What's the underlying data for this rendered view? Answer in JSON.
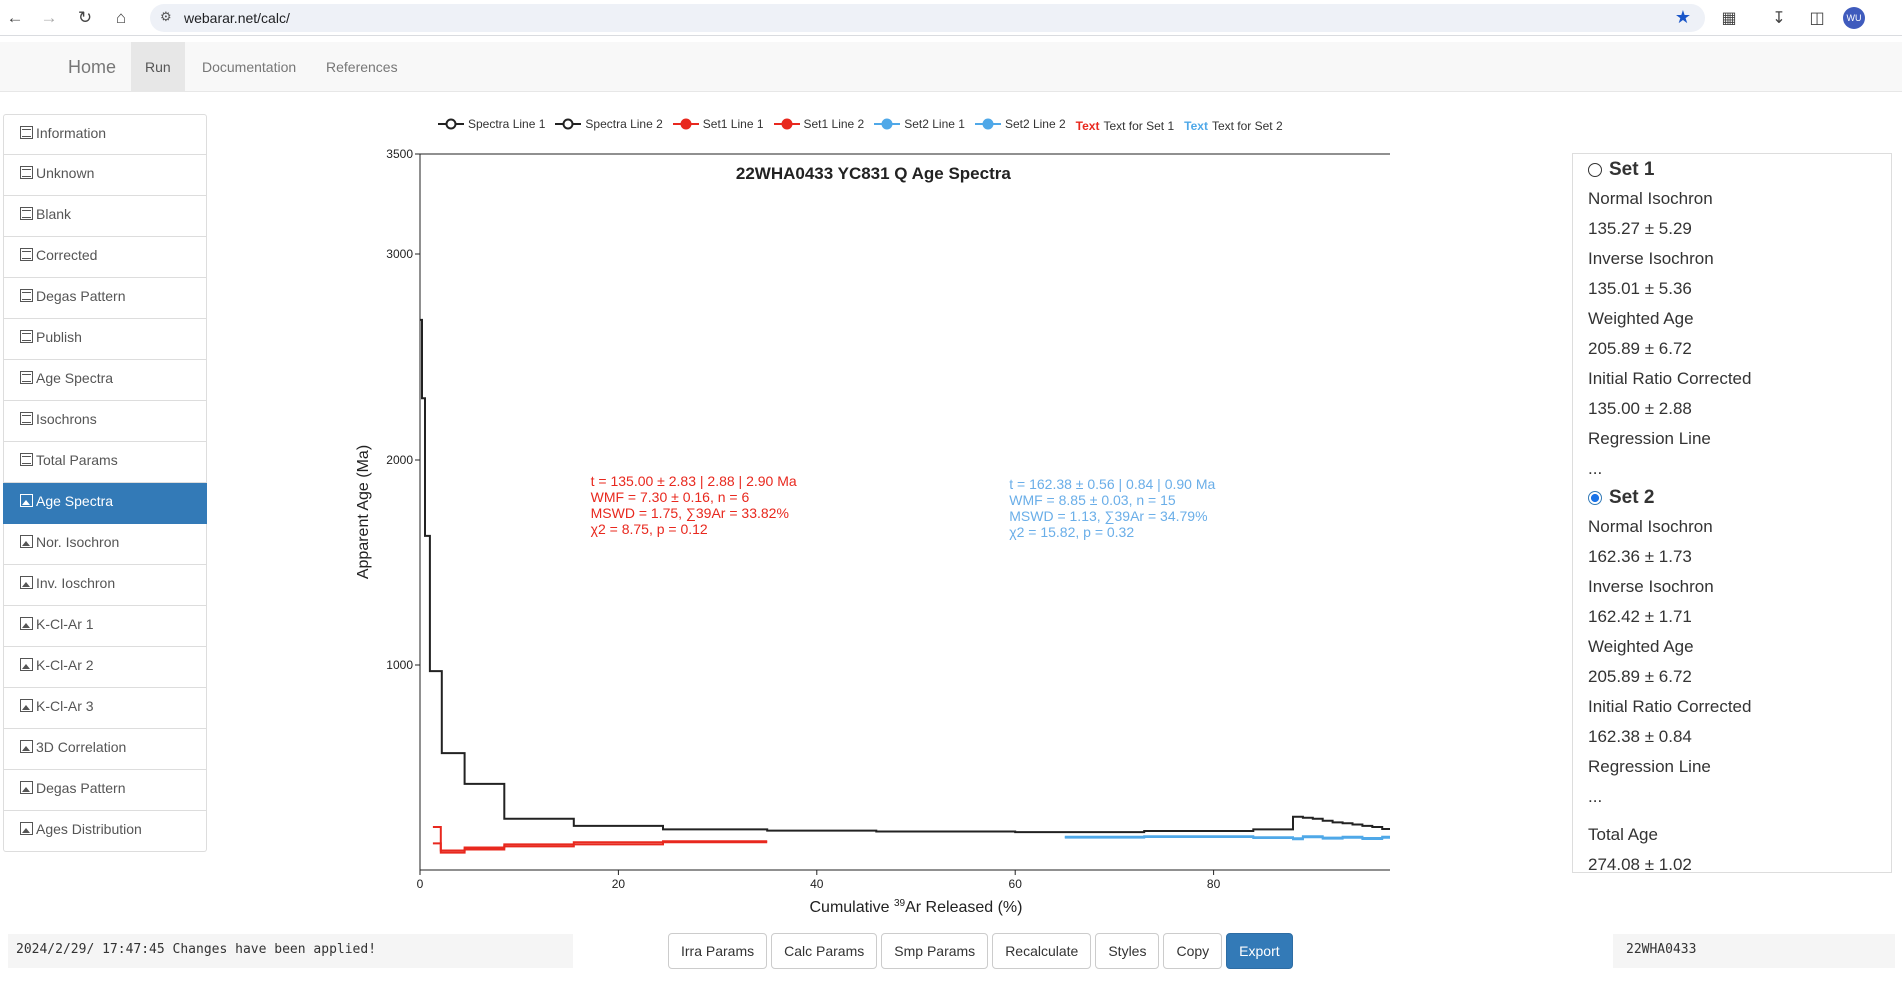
{
  "browser": {
    "url": "webarar.net/calc/",
    "avatar_initials": "WU"
  },
  "navbar": {
    "home": "Home",
    "run": "Run",
    "documentation": "Documentation",
    "references": "References"
  },
  "sidebar": {
    "items": [
      {
        "label": "Information",
        "icon": "table-icon"
      },
      {
        "label": "Unknown",
        "icon": "table-icon"
      },
      {
        "label": "Blank",
        "icon": "table-icon"
      },
      {
        "label": "Corrected",
        "icon": "table-icon"
      },
      {
        "label": "Degas Pattern",
        "icon": "table-icon"
      },
      {
        "label": "Publish",
        "icon": "table-icon"
      },
      {
        "label": "Age Spectra",
        "icon": "table-icon"
      },
      {
        "label": "Isochrons",
        "icon": "table-icon"
      },
      {
        "label": "Total Params",
        "icon": "table-icon"
      },
      {
        "label": "Age Spectra",
        "icon": "image-icon"
      },
      {
        "label": "Nor. Isochron",
        "icon": "image-icon"
      },
      {
        "label": "Inv. Ioschron",
        "icon": "image-icon"
      },
      {
        "label": "K-Cl-Ar 1",
        "icon": "image-icon"
      },
      {
        "label": "K-Cl-Ar 2",
        "icon": "image-icon"
      },
      {
        "label": "K-Cl-Ar 3",
        "icon": "image-icon"
      },
      {
        "label": "3D Correlation",
        "icon": "image-icon"
      },
      {
        "label": "Degas Pattern",
        "icon": "image-icon"
      },
      {
        "label": "Ages Distribution",
        "icon": "image-icon"
      }
    ],
    "active_index": 9
  },
  "legend": {
    "items": [
      {
        "label": "Spectra Line 1",
        "color": "#222222",
        "filled": false
      },
      {
        "label": "Spectra Line 2",
        "color": "#222222",
        "filled": false
      },
      {
        "label": "Set1 Line 1",
        "color": "#e8281e",
        "filled": true
      },
      {
        "label": "Set1 Line 2",
        "color": "#e8281e",
        "filled": true
      },
      {
        "label": "Set2 Line 1",
        "color": "#4fa8e8",
        "filled": true
      },
      {
        "label": "Set2 Line 2",
        "color": "#4fa8e8",
        "filled": true
      }
    ],
    "text_items": [
      {
        "mark": "Text",
        "label": "Text for Set 1",
        "color": "#e8281e"
      },
      {
        "mark": "Text",
        "label": "Text for Set 2",
        "color": "#4fa8e8"
      }
    ]
  },
  "chart_data": {
    "type": "line",
    "title": "22WHA0433 YC831 Q Age Spectra",
    "xlabel": "Cumulative 39Ar Released (%)",
    "ylabel": "Apparent Age (Ma)",
    "xlim": [
      0,
      100
    ],
    "ylim": [
      0,
      3500
    ],
    "y_scale": "piecewise",
    "xticks": [
      0,
      20,
      40,
      60,
      80,
      100
    ],
    "yticks": [
      1000,
      2000,
      3000,
      3500
    ],
    "series": [
      {
        "name": "Spectra Line 1",
        "color": "#222222",
        "x": [
          0,
          0.2,
          0.2,
          0.5,
          0.5,
          1.0,
          1.0,
          2.2,
          2.2,
          4.5,
          4.5,
          8.5,
          8.5,
          15.5,
          15.5,
          24.5,
          24.5,
          35,
          35,
          46,
          46,
          60,
          60,
          73,
          73,
          84,
          84,
          88,
          88,
          89,
          89,
          90,
          90,
          91,
          91,
          92,
          92,
          93,
          93,
          94,
          94,
          95,
          95,
          96,
          96,
          97,
          97,
          100
        ],
        "y": [
          2680,
          2680,
          2300,
          2300,
          1630,
          1630,
          970,
          970,
          570,
          570,
          420,
          420,
          250,
          250,
          215,
          215,
          198,
          198,
          192,
          192,
          188,
          188,
          185,
          185,
          190,
          190,
          198,
          198,
          260,
          260,
          255,
          255,
          250,
          250,
          240,
          240,
          232,
          232,
          228,
          228,
          222,
          222,
          215,
          215,
          210,
          210,
          200,
          200
        ]
      },
      {
        "name": "Set1 Line 1",
        "color": "#e8281e",
        "x": [
          1.3,
          2.1,
          2.1,
          4.5,
          4.5,
          8.5,
          8.5,
          15.5,
          15.5,
          24.5,
          24.5,
          35
        ],
        "y": [
          210,
          210,
          95,
          95,
          110,
          110,
          125,
          125,
          135,
          135,
          140,
          140
        ]
      },
      {
        "name": "Set1 Line 2",
        "color": "#e8281e",
        "x": [
          1.3,
          2.1,
          2.1,
          4.5,
          4.5,
          8.5,
          8.5,
          15.5,
          15.5,
          24.5,
          24.5,
          35
        ],
        "y": [
          130,
          130,
          85,
          85,
          100,
          100,
          115,
          115,
          125,
          125,
          135,
          135
        ]
      },
      {
        "name": "Set2 Line 1",
        "color": "#4fa8e8",
        "x": [
          65,
          73,
          73,
          84,
          84,
          88,
          88,
          89,
          89,
          91,
          91,
          93,
          93,
          95,
          95,
          97,
          97,
          100
        ],
        "y": [
          162,
          162,
          165,
          165,
          160,
          160,
          155,
          155,
          165,
          165,
          158,
          158,
          162,
          162,
          156,
          156,
          162,
          162
        ]
      },
      {
        "name": "Set2 Line 2",
        "color": "#4fa8e8",
        "x": [
          65,
          73,
          73,
          84,
          84,
          88,
          88,
          89,
          89,
          91,
          91,
          93,
          93,
          95,
          95,
          97,
          97,
          100
        ],
        "y": [
          158,
          158,
          161,
          161,
          156,
          156,
          150,
          150,
          160,
          160,
          153,
          153,
          157,
          157,
          151,
          151,
          157,
          157
        ]
      }
    ],
    "annotations": [
      {
        "color": "#e8281e",
        "lines": [
          "t = 135.00 ± 2.83 | 2.88 | 2.90 Ma",
          "WMF = 7.30 ± 0.16, n = 6",
          "MSWD = 1.75, ∑39Ar = 33.82%",
          "χ2 = 8.75, p = 0.12"
        ]
      },
      {
        "color": "#6aaee8",
        "lines": [
          "t = 162.38 ± 0.56 | 0.84 | 0.90 Ma",
          "WMF = 8.85 ± 0.03, n = 15",
          "MSWD = 1.13, ∑39Ar = 34.79%",
          "χ2 = 15.82, p = 0.32"
        ]
      }
    ]
  },
  "right_panel": {
    "set1": {
      "title": "Set 1",
      "lines": [
        "Normal Isochron",
        "135.27 ± 5.29",
        "Inverse Isochron",
        "135.01 ± 5.36",
        "Weighted Age",
        "205.89 ± 6.72",
        "Initial Ratio Corrected",
        "135.00 ± 2.88",
        "Regression Line",
        "..."
      ]
    },
    "set2": {
      "title": "Set 2",
      "lines": [
        "Normal Isochron",
        "162.36 ± 1.73",
        "Inverse Isochron",
        "162.42 ± 1.71",
        "Weighted Age",
        "205.89 ± 6.72",
        "Initial Ratio Corrected",
        "162.38 ± 0.84",
        "Regression Line",
        "..."
      ]
    },
    "total": {
      "label": "Total Age",
      "value": "274.08 ± 1.02"
    }
  },
  "footer": {
    "status": "2024/2/29/ 17:47:45 Changes have been applied!",
    "sample_name": "22WHA0433",
    "buttons": [
      "Irra Params",
      "Calc Params",
      "Smp Params",
      "Recalculate",
      "Styles",
      "Copy",
      "Export"
    ]
  }
}
